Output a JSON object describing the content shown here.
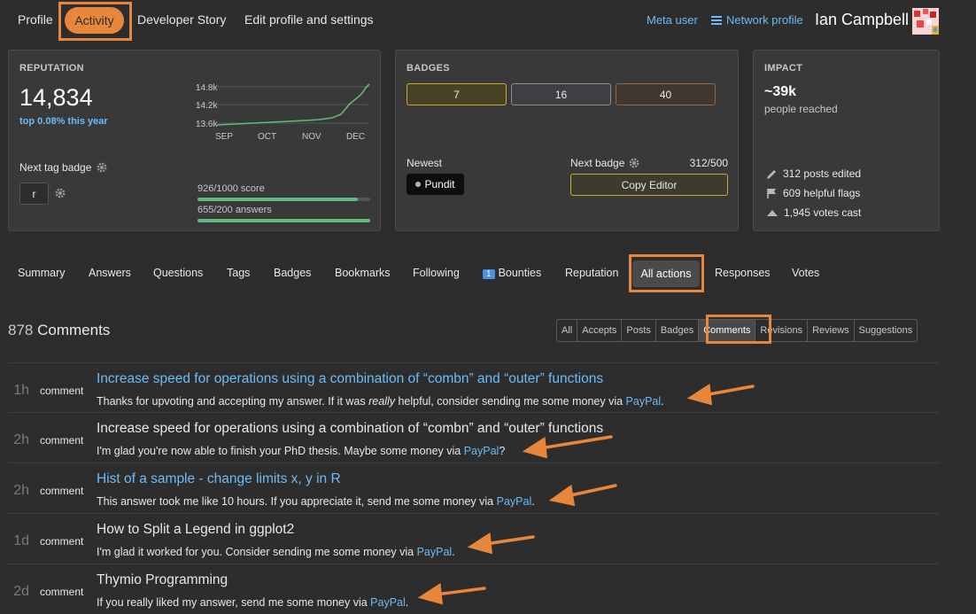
{
  "nav": {
    "profile": "Profile",
    "activity": "Activity",
    "developer_story": "Developer Story",
    "edit_profile": "Edit profile and settings",
    "meta_user": "Meta user",
    "network_profile": "Network profile",
    "user_name": "Ian Campbell"
  },
  "reputation": {
    "header": "REPUTATION",
    "value": "14,834",
    "top": "top 0.08% this year",
    "chart_labels": {
      "y": [
        "14.8k",
        "14.2k",
        "13.6k"
      ],
      "x": [
        "SEP",
        "OCT",
        "NOV",
        "DEC"
      ]
    },
    "next_tag_badge": "Next tag badge",
    "tag": "r",
    "score_progress": "926/1000 score",
    "score_fraction": 0.926,
    "answers_progress": "655/200 answers",
    "answers_fraction": 1.0
  },
  "badges": {
    "header": "BADGES",
    "gold": "7",
    "silver": "16",
    "bronze": "40",
    "newest_label": "Newest",
    "newest_badge": "Pundit",
    "next_badge_label": "Next badge",
    "next_badge_progress": "312/500",
    "next_badge_name": "Copy Editor"
  },
  "impact": {
    "header": "IMPACT",
    "reached": "~39k",
    "reached_label": "people reached",
    "posts_edited": "312 posts edited",
    "helpful_flags": "609 helpful flags",
    "votes_cast": "1,945 votes cast"
  },
  "subtabs": {
    "summary": "Summary",
    "answers": "Answers",
    "questions": "Questions",
    "tags": "Tags",
    "badges": "Badges",
    "bookmarks": "Bookmarks",
    "following": "Following",
    "bounties_count": "1",
    "bounties": "Bounties",
    "reputation": "Reputation",
    "all_actions": "All actions",
    "responses": "Responses",
    "votes": "Votes"
  },
  "comments": {
    "count": "878",
    "label": "Comments",
    "filters": [
      "All",
      "Accepts",
      "Posts",
      "Badges",
      "Comments",
      "Revisions",
      "Reviews",
      "Suggestions"
    ],
    "rows": [
      {
        "age": "1h",
        "type": "comment",
        "title": "Increase speed for operations using a combination of “combn” and “outer” functions",
        "text_pre": "Thanks for upvoting and accepting my answer. If it was ",
        "text_em": "really",
        "text_post": " helpful, consider sending me some money via ",
        "link": "PayPal",
        "end": "."
      },
      {
        "age": "2h",
        "type": "comment",
        "title": "Increase speed for operations using a combination of “combn” and “outer” functions",
        "text": "I'm glad you're now able to finish your PhD thesis. Maybe some money via ",
        "link": "PayPal",
        "end": "?"
      },
      {
        "age": "2h",
        "type": "comment",
        "title": "Hist of a sample - change limits x, y in R",
        "text": "This answer took me like 10 hours. If you appreciate it, send me some money via ",
        "link": "PayPal",
        "end": "."
      },
      {
        "age": "1d",
        "type": "comment",
        "title": "How to Split a Legend in ggplot2",
        "text": "I'm glad it worked for you. Consider sending me some money via ",
        "link": "PayPal",
        "end": "."
      },
      {
        "age": "2d",
        "type": "comment",
        "title": "Thymio Programming",
        "text": "If you really liked my answer, send me some money via ",
        "link": "PayPal",
        "end": "."
      }
    ]
  },
  "colors": {
    "accent": "#e8873b",
    "link": "#6cbbf7",
    "progress": "#5eba7d"
  }
}
